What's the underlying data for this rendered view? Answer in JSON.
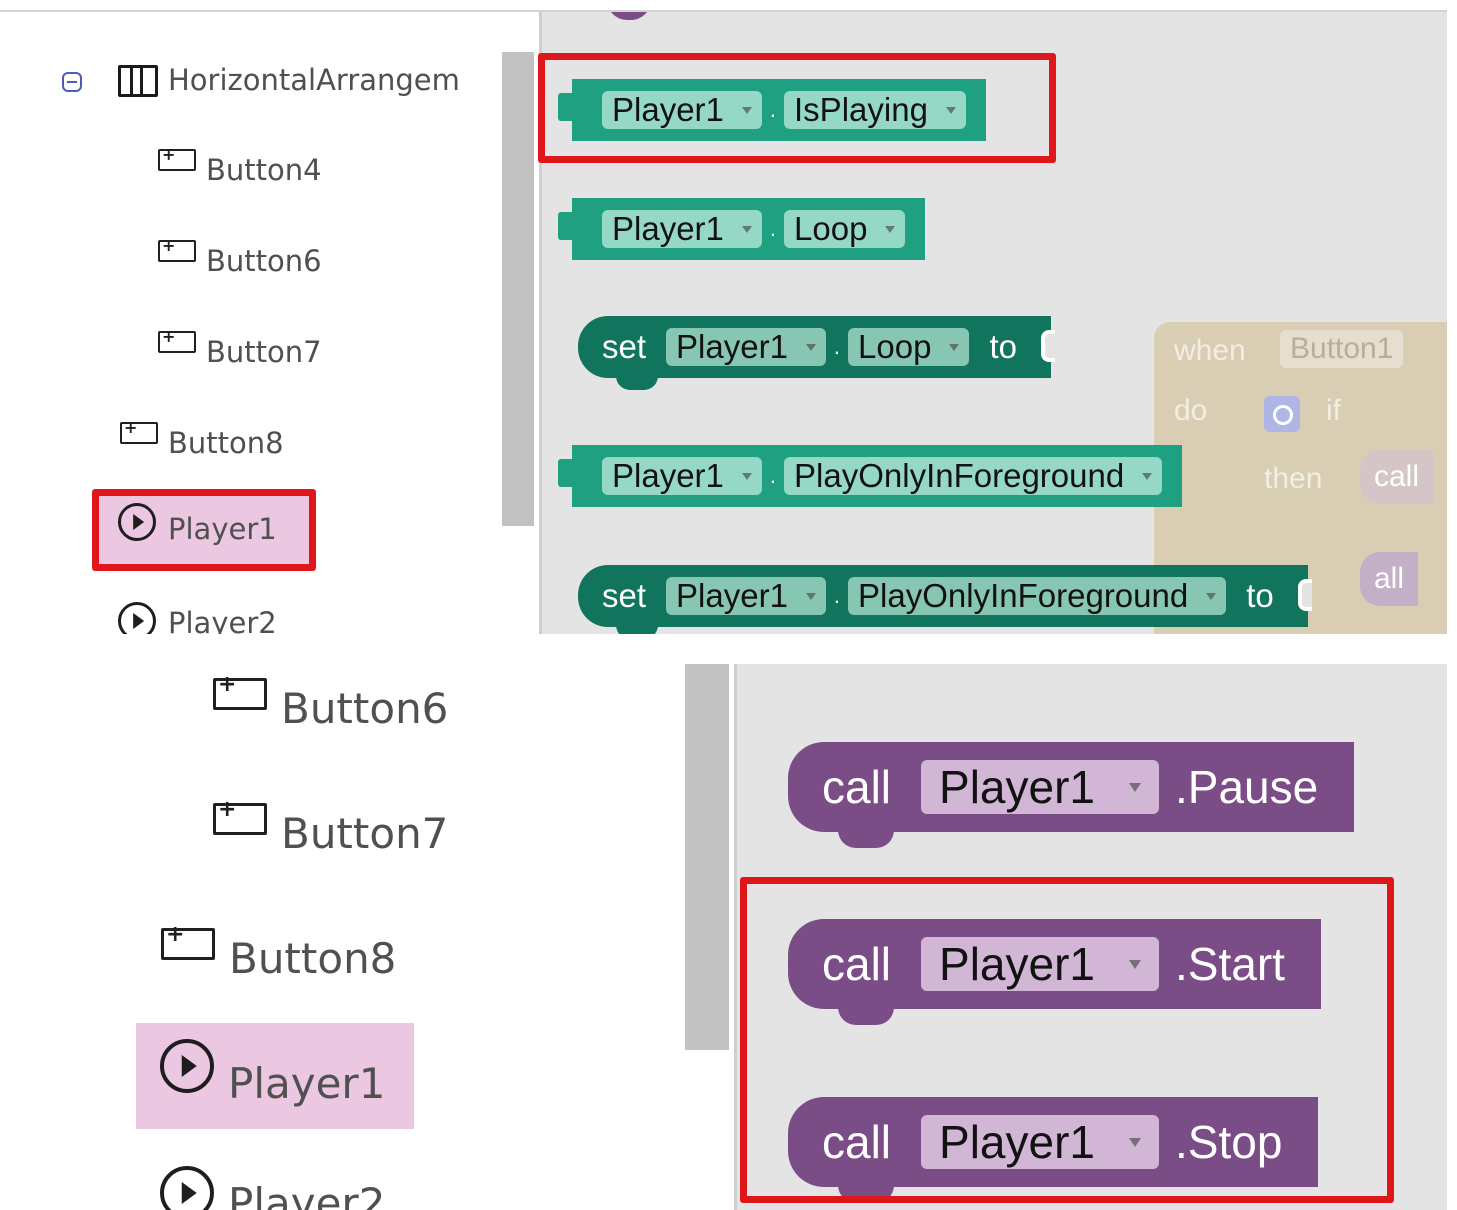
{
  "colors": {
    "highlight_outline": "#e0161d",
    "selected_bg": "#ecc7e1",
    "component_block": "#1ea081",
    "setter_block": "#11745d",
    "method_block": "#7b4d87",
    "event_block": "#d9cdb3"
  },
  "tree_top": {
    "horizontal_arrangement": "HorizontalArrangem",
    "items": [
      "Button4",
      "Button6",
      "Button7",
      "Button8",
      "Player1",
      "Player2"
    ]
  },
  "tree_bottom": {
    "items": [
      "Button6",
      "Button7",
      "Button8",
      "Player1",
      "Player2"
    ]
  },
  "blocks_top": {
    "isplaying": {
      "component": "Player1",
      "dot": ".",
      "property": "IsPlaying"
    },
    "loop": {
      "component": "Player1",
      "dot": ".",
      "property": "Loop"
    },
    "set_loop": {
      "set": "set",
      "component": "Player1",
      "dot": ".",
      "property": "Loop",
      "to": "to"
    },
    "play_only": {
      "component": "Player1",
      "dot": ".",
      "property": "PlayOnlyInForeground"
    },
    "set_play_only": {
      "set": "set",
      "component": "Player1",
      "dot": ".",
      "property": "PlayOnlyInForeground",
      "to": "to"
    },
    "event": {
      "when": "when",
      "component": "Button1",
      "do": "do",
      "if": "if",
      "then": "then",
      "call": "call",
      "call_partial": "all"
    }
  },
  "blocks_bottom": {
    "pause": {
      "call": "call",
      "component": "Player1",
      "method": ".Pause"
    },
    "start": {
      "call": "call",
      "component": "Player1",
      "method": ".Start"
    },
    "stop": {
      "call": "call",
      "component": "Player1",
      "method": ".Stop"
    }
  },
  "icons": [
    "collapse-icon",
    "horizontal-arrangement-icon",
    "button-icon",
    "player-icon",
    "gear-icon",
    "dropdown-caret-icon"
  ]
}
